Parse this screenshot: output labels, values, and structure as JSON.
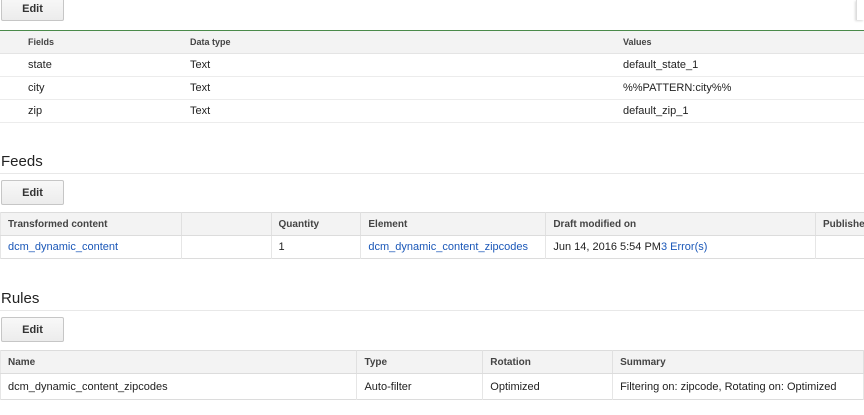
{
  "top": {
    "edit_label": "Edit"
  },
  "fields_table": {
    "headers": [
      "Fields",
      "Data type",
      "Values"
    ],
    "rows": [
      [
        "state",
        "Text",
        "default_state_1"
      ],
      [
        "city",
        "Text",
        "%%PATTERN:city%%"
      ],
      [
        "zip",
        "Text",
        "default_zip_1"
      ]
    ]
  },
  "feeds": {
    "title": "Feeds",
    "edit_label": "Edit",
    "headers": [
      "Transformed content",
      "",
      "Quantity",
      "Element",
      "Draft modified on",
      "Published"
    ],
    "row": {
      "transformed_content": "dcm_dynamic_content",
      "quantity": "1",
      "element": "dcm_dynamic_content_zipcodes",
      "draft_modified": "Jun 14, 2016 5:54 PM",
      "errors": "3 Error(s)"
    }
  },
  "rules": {
    "title": "Rules",
    "edit_label": "Edit",
    "headers": [
      "Name",
      "Type",
      "Rotation",
      "Summary"
    ],
    "row": {
      "name": "dcm_dynamic_content_zipcodes",
      "type": "Auto-filter",
      "rotation": "Optimized",
      "summary": "Filtering on: zipcode, Rotating on: Optimized"
    }
  },
  "colors": {
    "link": "#1a57b8",
    "top_rule": "#4a8a4a"
  }
}
